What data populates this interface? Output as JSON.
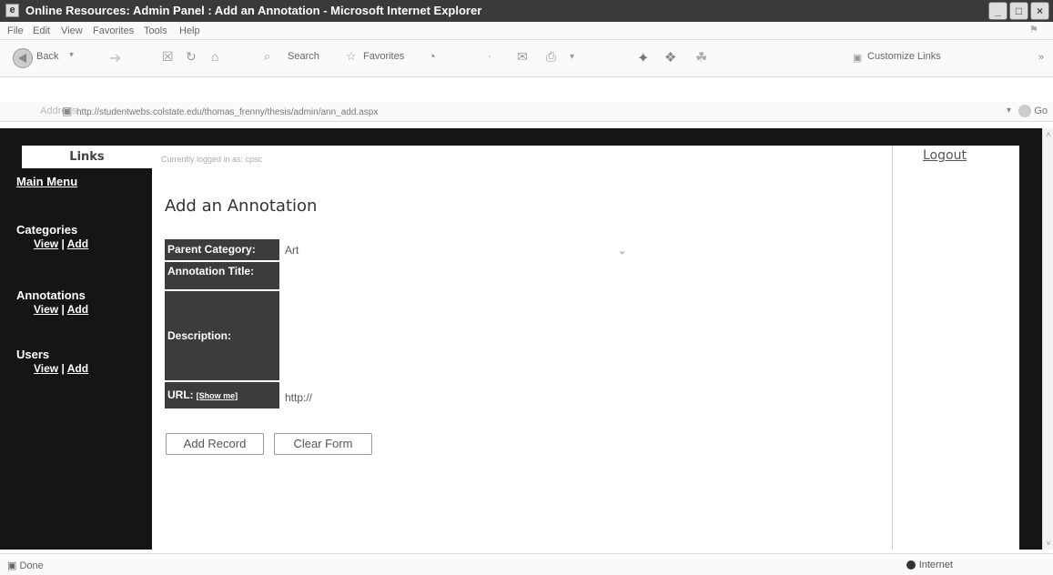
{
  "window": {
    "title": "Online Resources: Admin Panel : Add an Annotation - Microsoft Internet Explorer",
    "minimize": "_",
    "maximize": "□",
    "close": "×"
  },
  "menu": [
    "File",
    "Edit",
    "View",
    "Favorites",
    "Tools",
    "Help"
  ],
  "toolbar": {
    "back": "Back",
    "search": "Search",
    "favorites": "Favorites",
    "customize_links": "Customize Links"
  },
  "address": {
    "label": "Address",
    "url": "http://studentwebs.colstate.edu/thomas_frenny/thesis/admin/ann_add.aspx",
    "go": "Go"
  },
  "sidebar": {
    "header": "Links",
    "main_menu": "Main Menu",
    "sections": [
      {
        "title": "Categories",
        "view": "View",
        "sep": " | ",
        "add": "Add"
      },
      {
        "title": "Annotations",
        "view": "View",
        "sep": " | ",
        "add": "Add"
      },
      {
        "title": "Users",
        "view": "View",
        "sep": " | ",
        "add": "Add"
      }
    ]
  },
  "main": {
    "logged_in": "Currently logged in as: cpsc",
    "heading": "Add an Annotation",
    "labels": {
      "parent_category": "Parent Category:",
      "annotation_title": "Annotation Title:",
      "description": "Description:",
      "url": "URL:",
      "show_me": "[Show me]"
    },
    "values": {
      "parent_category": "Art",
      "url": "http://"
    },
    "buttons": {
      "add": "Add Record",
      "clear": "Clear Form"
    }
  },
  "right": {
    "logout": "Logout"
  },
  "status": {
    "text": "Done",
    "zone": "Internet"
  }
}
